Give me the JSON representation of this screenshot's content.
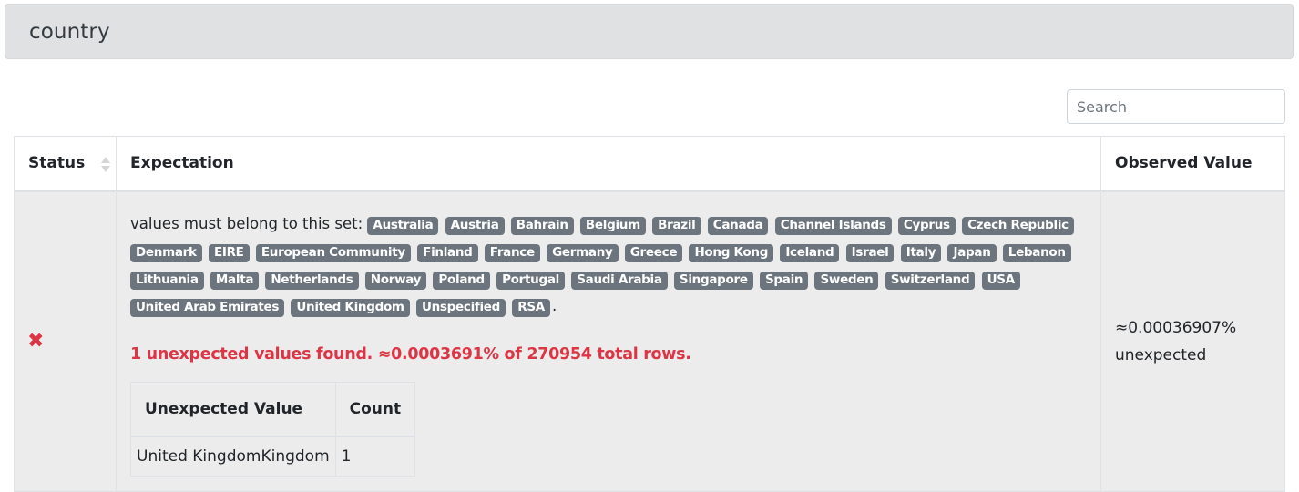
{
  "header": {
    "title": "country"
  },
  "search": {
    "placeholder": "Search",
    "value": ""
  },
  "table": {
    "columns": [
      "Status",
      "Expectation",
      "Observed Value"
    ],
    "rows": [
      {
        "status": "failed",
        "status_icon": "x-icon",
        "expectation_prefix": "values must belong to this set:",
        "value_set": [
          "Australia",
          "Austria",
          "Bahrain",
          "Belgium",
          "Brazil",
          "Canada",
          "Channel Islands",
          "Cyprus",
          "Czech Republic",
          "Denmark",
          "EIRE",
          "European Community",
          "Finland",
          "France",
          "Germany",
          "Greece",
          "Hong Kong",
          "Iceland",
          "Israel",
          "Italy",
          "Japan",
          "Lebanon",
          "Lithuania",
          "Malta",
          "Netherlands",
          "Norway",
          "Poland",
          "Portugal",
          "Saudi Arabia",
          "Singapore",
          "Spain",
          "Sweden",
          "Switzerland",
          "USA",
          "United Arab Emirates",
          "United Kingdom",
          "Unspecified",
          "RSA"
        ],
        "expectation_suffix": ".",
        "unexpected_message": "1 unexpected values found. ≈0.0003691% of 270954 total rows.",
        "unexpected_table": {
          "headers": [
            "Unexpected Value",
            "Count"
          ],
          "rows": [
            {
              "value": "United KingdomKingdom",
              "count": "1"
            }
          ]
        },
        "observed_value": "≈0.00036907% unexpected"
      }
    ]
  },
  "colors": {
    "failure": "#dc3545",
    "badge": "#6c757d",
    "header_bg": "#e0e1e3"
  }
}
